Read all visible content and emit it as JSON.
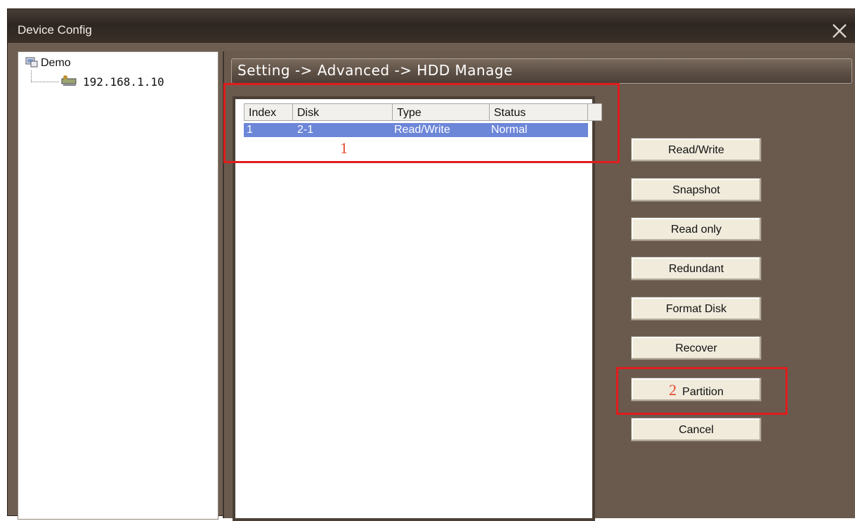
{
  "window": {
    "title": "Device Config"
  },
  "tree": {
    "root_label": "Demo",
    "child_label": "192.168.1.10"
  },
  "content": {
    "heading": "Setting -> Advanced -> HDD Manage"
  },
  "disk_table": {
    "columns": [
      "Index",
      "Disk",
      "Type",
      "Status"
    ],
    "rows": [
      {
        "index": "1",
        "disk": "2-1",
        "type": "Read/Write",
        "status": "Normal"
      }
    ]
  },
  "buttons": {
    "read_write": "Read/Write",
    "snapshot": "Snapshot",
    "read_only": "Read only",
    "redundant": "Redundant",
    "format_disk": "Format Disk",
    "recover": "Recover",
    "partition": "Partition",
    "cancel": "Cancel"
  },
  "annotations": {
    "step1": "1",
    "step2": "2",
    "color": "#e01c1c"
  },
  "colors": {
    "selection": "#6c86d8",
    "panel_bg": "#6a5a4e",
    "title_bg": "#2e2622"
  }
}
